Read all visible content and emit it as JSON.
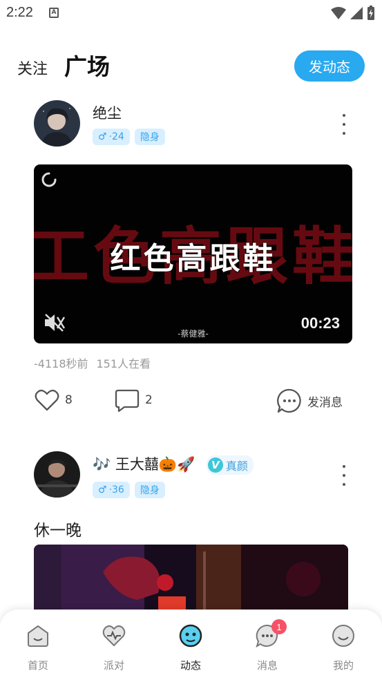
{
  "status_bar": {
    "time": "2:22",
    "a_icon_letter": "A"
  },
  "header": {
    "tab_follow": "关注",
    "tab_square": "广场",
    "post_button": "发动态"
  },
  "posts": [
    {
      "username": "绝尘",
      "gender_symbol": "♂",
      "age": "·24",
      "status_badge": "隐身",
      "video": {
        "title": "红色高跟鞋",
        "bg_text": "工色高跟鞋",
        "credit": "-蔡健雅-",
        "duration": "00:23"
      },
      "time_ago": "-4118秒前",
      "viewers": "151人在看",
      "likes": "8",
      "comments": "2",
      "message_label": "发消息"
    },
    {
      "username": "🎶 王大囍🎃🚀",
      "verified_label": "真颜",
      "verified_letter": "V",
      "gender_symbol": "♂",
      "age": "·36",
      "status_badge": "隐身",
      "text": "休一晚"
    }
  ],
  "bottom_nav": {
    "items": [
      {
        "label": "首页",
        "icon": "home-face-icon"
      },
      {
        "label": "派对",
        "icon": "heartbeat-icon"
      },
      {
        "label": "动态",
        "icon": "planet-icon"
      },
      {
        "label": "消息",
        "icon": "chat-dots-icon"
      },
      {
        "label": "我的",
        "icon": "smile-icon"
      }
    ],
    "message_badge": "1",
    "active_index": 2
  },
  "colors": {
    "accent": "#29a9f0",
    "badge_bg": "#d8efff",
    "badge_text": "#39a3e8",
    "notification": "#f55268"
  }
}
